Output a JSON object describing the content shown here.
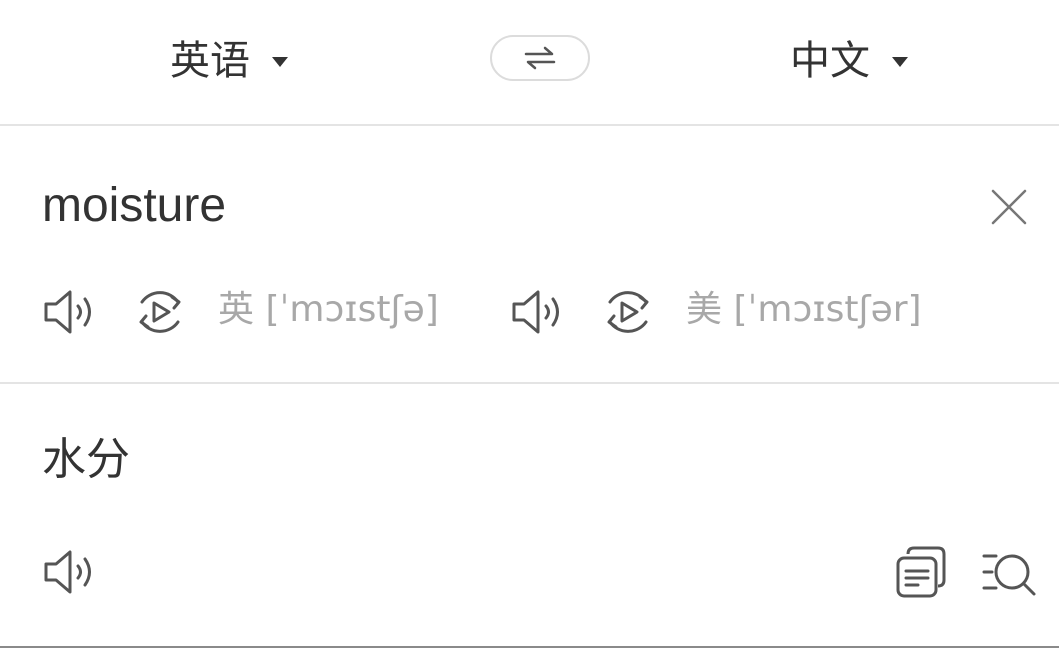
{
  "lang_bar": {
    "source_lang": "英语",
    "target_lang": "中文",
    "swap_symbol": "⇌"
  },
  "source": {
    "text": "moisture",
    "uk_phonetic": "英 [ˈmɔɪstʃə]",
    "us_phonetic": "美 [ˈmɔɪstʃər]"
  },
  "result": {
    "text": "水分"
  },
  "icons": {
    "speaker": "speaker-icon",
    "replay": "replay-icon",
    "clear": "close-icon",
    "copy": "copy-icon",
    "lookup": "search-list-icon",
    "dropdown": "caret-down-icon",
    "swap": "swap-icon"
  },
  "colors": {
    "text": "#333333",
    "muted": "#a8a8a8",
    "icon": "#555555",
    "divider": "#e4e4e4"
  }
}
